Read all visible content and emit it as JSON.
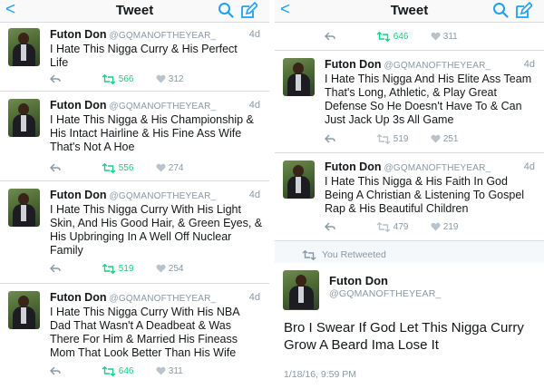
{
  "nav": {
    "back": "<",
    "title": "Tweet"
  },
  "author": {
    "name": "Futon Don",
    "handle": "@GQMANOFTHEYEAR_",
    "handle_short": "@GQMANOFTHEYEAR"
  },
  "left_tweets": [
    {
      "time": "4d",
      "text": "I Hate This Nigga Curry & His Perfect\nLife",
      "retweets": "566",
      "likes": "312"
    },
    {
      "time": "4d",
      "text": "I Hate This Nigga & His Championship &\nHis Intact Hairline & His Fine Ass Wife\nThat's Not A Hoe",
      "retweets": "556",
      "likes": "274"
    },
    {
      "time": "4d",
      "text": "I Hate This Nigga Curry With His Light\nSkin, And His Good Hair, & Green Eyes, &\nHis Upbringing In A Well Off Nuclear\nFamily",
      "retweets": "519",
      "likes": "254"
    },
    {
      "time": "4d",
      "text": "I Hate This Nigga Curry With His NBA\nDad That Wasn't A Deadbeat & Was\nThere For Him & Married His Fineass\nMom That Look Better Than His Wife",
      "retweets": "646",
      "likes": "311"
    }
  ],
  "right_cut": {
    "retweets": "646",
    "likes": "311"
  },
  "right_tweets": [
    {
      "time": "4d",
      "text": "I Hate This Nigga And His Elite Ass Team\nThat's Long, Athletic, & Play Great\nDefense So He Doesn't Have To & Can\nJust Jack Up 3s All Game",
      "retweets": "519",
      "likes": "251"
    },
    {
      "time": "4d",
      "text": "I Hate This Nigga & His Faith In God\nBeing A Christian & Listening To Gospel\nRap & His Beautiful Children",
      "retweets": "479",
      "likes": "219"
    }
  ],
  "retweet_note": "You Retweeted",
  "focus": {
    "text": "Bro I Swear If God Let This Nigga Curry\nGrow A Beard Ima Lose It",
    "timestamp": "1/18/16, 9:59 PM"
  },
  "colors": {
    "accent": "#1da1f2",
    "retweet_active": "#19cf86",
    "muted": "#8899a6"
  }
}
